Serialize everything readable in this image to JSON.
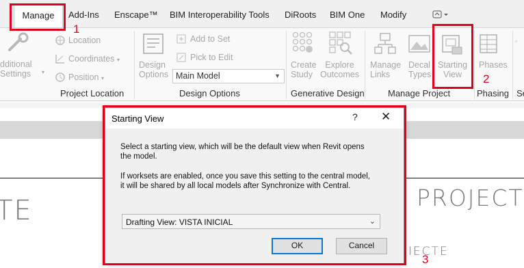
{
  "ribbon": {
    "tabs": [
      {
        "label": "Manage",
        "active": true
      },
      {
        "label": "Add-Ins"
      },
      {
        "label": "Enscape™"
      },
      {
        "label": "BIM Interoperability Tools"
      },
      {
        "label": "DiRoots"
      },
      {
        "label": "BIM One"
      },
      {
        "label": "Modify"
      }
    ],
    "project_location": {
      "additional_settings_line1": "dditional",
      "additional_settings_line2": "Settings",
      "location": "Location",
      "coordinates": "Coordinates",
      "position": "Position",
      "title": "Project Location"
    },
    "design_options": {
      "design_line1": "Design",
      "design_line2": "Options",
      "add_to_set": "Add to Set",
      "pick_to_edit": "Pick to Edit",
      "main_model": "Main Model",
      "title": "Design Options"
    },
    "generative_design": {
      "create_line1": "Create",
      "create_line2": "Study",
      "explore_line1": "Explore",
      "explore_line2": "Outcomes",
      "title": "Generative Design"
    },
    "manage_project": {
      "manage_line1": "Manage",
      "manage_line2": "Links",
      "decal_line1": "Decal",
      "decal_line2": "Types",
      "starting_line1": "Starting",
      "starting_line2": "View",
      "title": "Manage Project"
    },
    "phasing": {
      "phases": "Phases",
      "title": "Phasing"
    },
    "partial_panel_title": "Se"
  },
  "dialog": {
    "title": "Starting View",
    "help_glyph": "?",
    "close_glyph": "✕",
    "message1_line1": "Select a starting view, which will be the default view when Revit opens",
    "message1_line2": "the model.",
    "message2_line1": "If worksets are enabled, once you save this setting to the central model,",
    "message2_line2": "it will be shared by all local models after Synchronize with Central.",
    "selected_view": "Drafting View: VISTA INICIAL",
    "ok": "OK",
    "cancel": "Cancel"
  },
  "drawing": {
    "left_fragment": "TE",
    "right_title": "PROJECTE",
    "right_small": "IECTE"
  },
  "annotations": [
    "1",
    "2",
    "3"
  ],
  "colors": {
    "annotation_red": "#e3001b",
    "ok_focus_blue": "#0078d7"
  }
}
